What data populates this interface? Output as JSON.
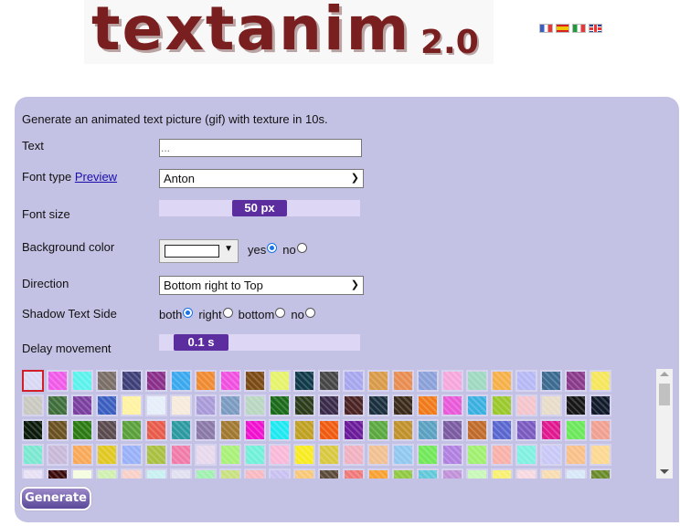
{
  "header": {
    "logo_text": "textanim",
    "logo_version": "2.0",
    "languages": [
      {
        "code": "fr",
        "label": "French"
      },
      {
        "code": "es",
        "label": "Spanish"
      },
      {
        "code": "it",
        "label": "Italian"
      },
      {
        "code": "en",
        "label": "English"
      }
    ]
  },
  "form": {
    "intro": "Generate an animated text picture (gif) with texture in 10s.",
    "text": {
      "label": "Text",
      "value": "",
      "placeholder": "..."
    },
    "font_type": {
      "label": "Font type",
      "preview_link": "Preview",
      "selected": "Anton"
    },
    "font_size": {
      "label": "Font size",
      "value_label": "50 px",
      "value": 50,
      "unit": "px",
      "fraction": 0.5
    },
    "background_color": {
      "label": "Background color",
      "color": "#ffffff",
      "arrow": "▼",
      "options": [
        {
          "label": "yes",
          "checked": true
        },
        {
          "label": "no",
          "checked": false
        }
      ]
    },
    "direction": {
      "label": "Direction",
      "selected": "Bottom right to Top"
    },
    "shadow": {
      "label": "Shadow Text Side",
      "options": [
        {
          "label": "both",
          "checked": true
        },
        {
          "label": "right",
          "checked": false
        },
        {
          "label": "bottom",
          "checked": false
        },
        {
          "label": "no",
          "checked": false
        }
      ]
    },
    "delay": {
      "label": "Delay movement",
      "value_label": "0.1 s",
      "value": 0.1,
      "unit": "s",
      "fraction": 0.0
    },
    "textures": {
      "selected_index": 0,
      "rows": [
        [
          "#d8d8f4",
          "#f05ae8",
          "#5cf2ec",
          "#7a6e66",
          "#3e3e78",
          "#8a2e8a",
          "#3aa8ee",
          "#f08a30",
          "#f050e0",
          "#7a4a12",
          "#e6f36a",
          "#103a4a",
          "#464646",
          "#a6a6ee",
          "#d89a48",
          "#e88c50",
          "#8aa0d8",
          "#f6a6dc",
          "#9ed8c0",
          "#f6b048",
          "#b4b8f4",
          "#3a6a90",
          "#8a3a8a",
          "#f6e65a"
        ],
        [
          "#c8c8c0",
          "#3e6e3a",
          "#7a3e9e",
          "#3a5ec0",
          "#fff2a0",
          "#e6eefa",
          "#f6eada",
          "#a89ad8",
          "#7a9ac0",
          "#b8d6c0",
          "#1a6a1a",
          "#2a3a1a",
          "#3a2a4a",
          "#4a2222",
          "#1a2e3e",
          "#3a2a1a",
          "#f07a1a",
          "#e858d8",
          "#3ab0e0",
          "#9ac82a",
          "#f4c4cc",
          "#e8dcc8",
          "#161616",
          "#101a2a"
        ],
        [
          "#0a1a0a",
          "#6a5020",
          "#2a7a12",
          "#5a4a4e",
          "#5aa03a",
          "#e85a4a",
          "#2a9aa0",
          "#8a78a8",
          "#a07830",
          "#f010d0",
          "#20e8f0",
          "#c0a020",
          "#f05a10",
          "#6a1a9a",
          "#5aa840",
          "#c0902a",
          "#5aa0c0",
          "#7a5aa0",
          "#c06a2a",
          "#5a66d0",
          "#7a5ac0",
          "#e01890",
          "#6ae85a",
          "#f0a090"
        ],
        [
          "#7ae8d0",
          "#c8b8d8",
          "#f8a858",
          "#e0c820",
          "#98b0f8",
          "#a8c040",
          "#f07aa8",
          "#e8d8ec",
          "#a8f078",
          "#70f0d8",
          "#f8b8d8",
          "#f8ec20",
          "#d8c840",
          "#f0b0c0",
          "#f0c090",
          "#90c8f0",
          "#70e858",
          "#b080e0",
          "#a0f070",
          "#f8b0a8",
          "#80f0e0",
          "#c8c8f8",
          "#f8c088",
          "#fcd890"
        ],
        [
          "#e8e0f4",
          "#3a0a0a",
          "#f4fce0",
          "#d0f0b0",
          "#f8d0c8",
          "#c8f0f0",
          "#e0e0f0",
          "#a0f0b0",
          "#c8e080",
          "#f8b8c0",
          "#c8c0f0",
          "#f8c878",
          "#5a4a3a",
          "#f07878",
          "#f8a030",
          "#90c840",
          "#60c8d8",
          "#c090d8",
          "#c8f8b8",
          "#f8f070",
          "#f8d8e0",
          "#f8dcb0",
          "#d8e8f8",
          "#6a8a2a"
        ]
      ],
      "scroll": {
        "up_icon": "▲",
        "down_icon": "▼"
      }
    },
    "generate_button": "Generate"
  }
}
